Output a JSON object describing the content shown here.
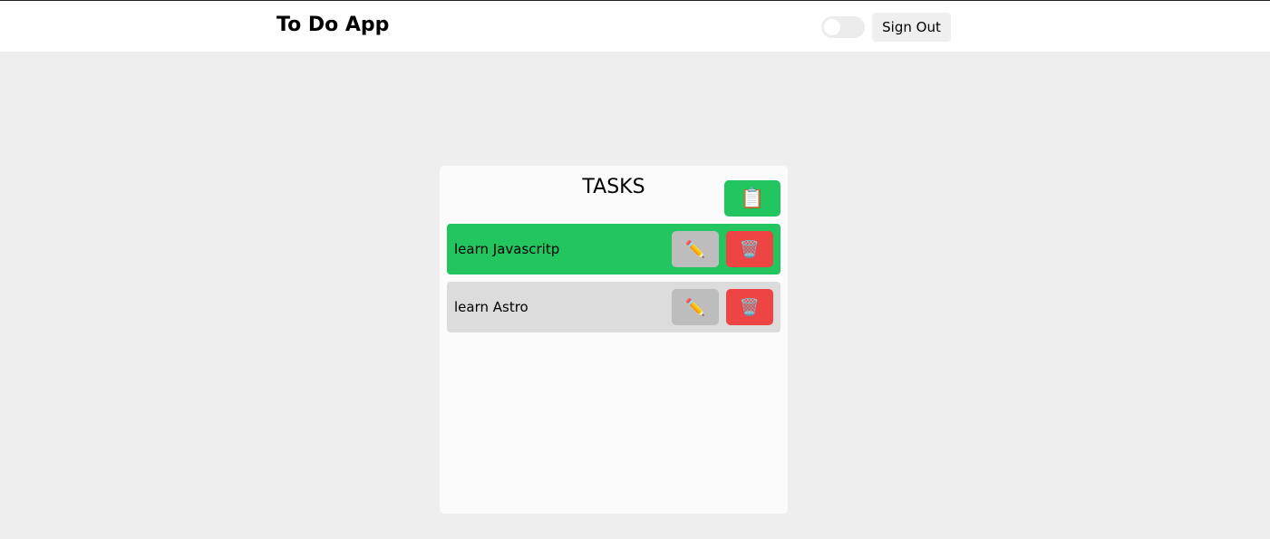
{
  "header": {
    "title": "To Do App",
    "theme_toggle": {
      "on": false
    },
    "sign_out_label": "Sign Out"
  },
  "tasks_card": {
    "title": "TASKS",
    "add_icon": "📋",
    "tasks": [
      {
        "label": "learn Javascritp",
        "done": true,
        "edit_icon": "✏️",
        "delete_icon": "🗑️"
      },
      {
        "label": "learn Astro",
        "done": false,
        "edit_icon": "✏️",
        "delete_icon": "🗑️"
      }
    ]
  },
  "colors": {
    "done": "#22c55e",
    "todo": "#dcdcdc",
    "delete": "#ef4444",
    "edit": "#bdbdbd"
  }
}
